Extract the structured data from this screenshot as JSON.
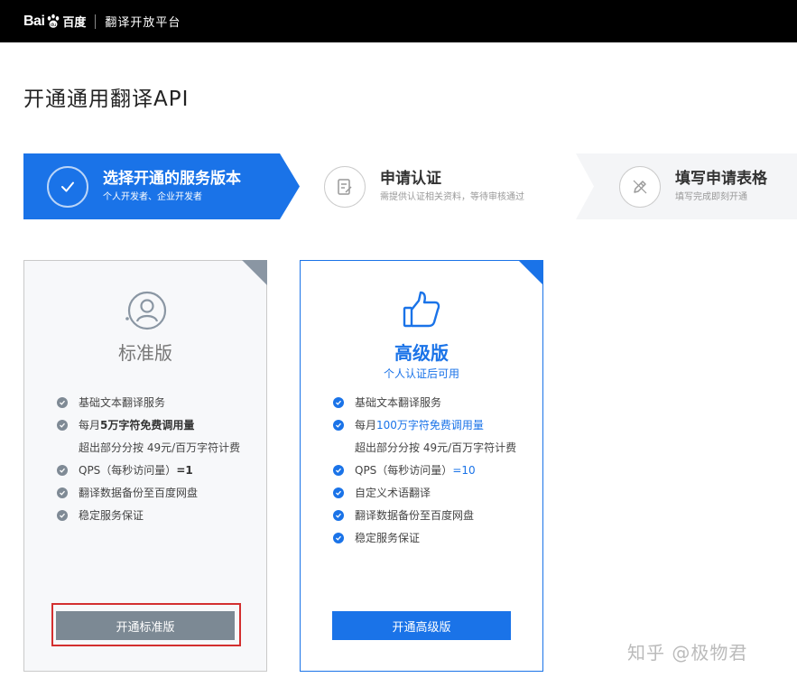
{
  "header": {
    "logo_bai": "Bai",
    "logo_du": "百度",
    "platform": "翻译开放平台"
  },
  "page": {
    "title": "开通通用翻译API"
  },
  "steps": [
    {
      "title": "选择开通的服务版本",
      "sub": "个人开发者、企业开发者",
      "icon": "check-icon",
      "active": true
    },
    {
      "title": "申请认证",
      "sub": "需提供认证相关资料，等待审核通过",
      "icon": "document-edit-icon",
      "active": false
    },
    {
      "title": "填写申请表格",
      "sub": "填写完成即刻开通",
      "icon": "pencil-icon",
      "active": false
    }
  ],
  "plans": {
    "standard": {
      "name": "标准版",
      "icon": "user-icon",
      "features": {
        "f1": "基础文本翻译服务",
        "f2_pre": "每月",
        "f2_hl": "5万字符免费调用量",
        "f2_cont": "超出部分分按 49元/百万字符计费",
        "f3_pre": "QPS（每秒访问量）",
        "f3_hl": "=1",
        "f4": "翻译数据备份至百度网盘",
        "f5": "稳定服务保证"
      },
      "button": "开通标准版"
    },
    "advanced": {
      "name": "高级版",
      "note": "个人认证后可用",
      "icon": "thumbs-up-icon",
      "features": {
        "f1": "基础文本翻译服务",
        "f2_pre": "每月",
        "f2_hl": "100万字符免费调用量",
        "f2_cont": "超出部分分按 49元/百万字符计费",
        "f3_pre": "QPS（每秒访问量）",
        "f3_hl": "=10",
        "f4": "自定义术语翻译",
        "f5": "翻译数据备份至百度网盘",
        "f6": "稳定服务保证"
      },
      "button": "开通高级版"
    }
  },
  "watermark": "知乎 @极物君",
  "colors": {
    "primary": "#1a73e8",
    "grey_button": "#7c8994",
    "highlight_outline": "#d32f2f"
  }
}
